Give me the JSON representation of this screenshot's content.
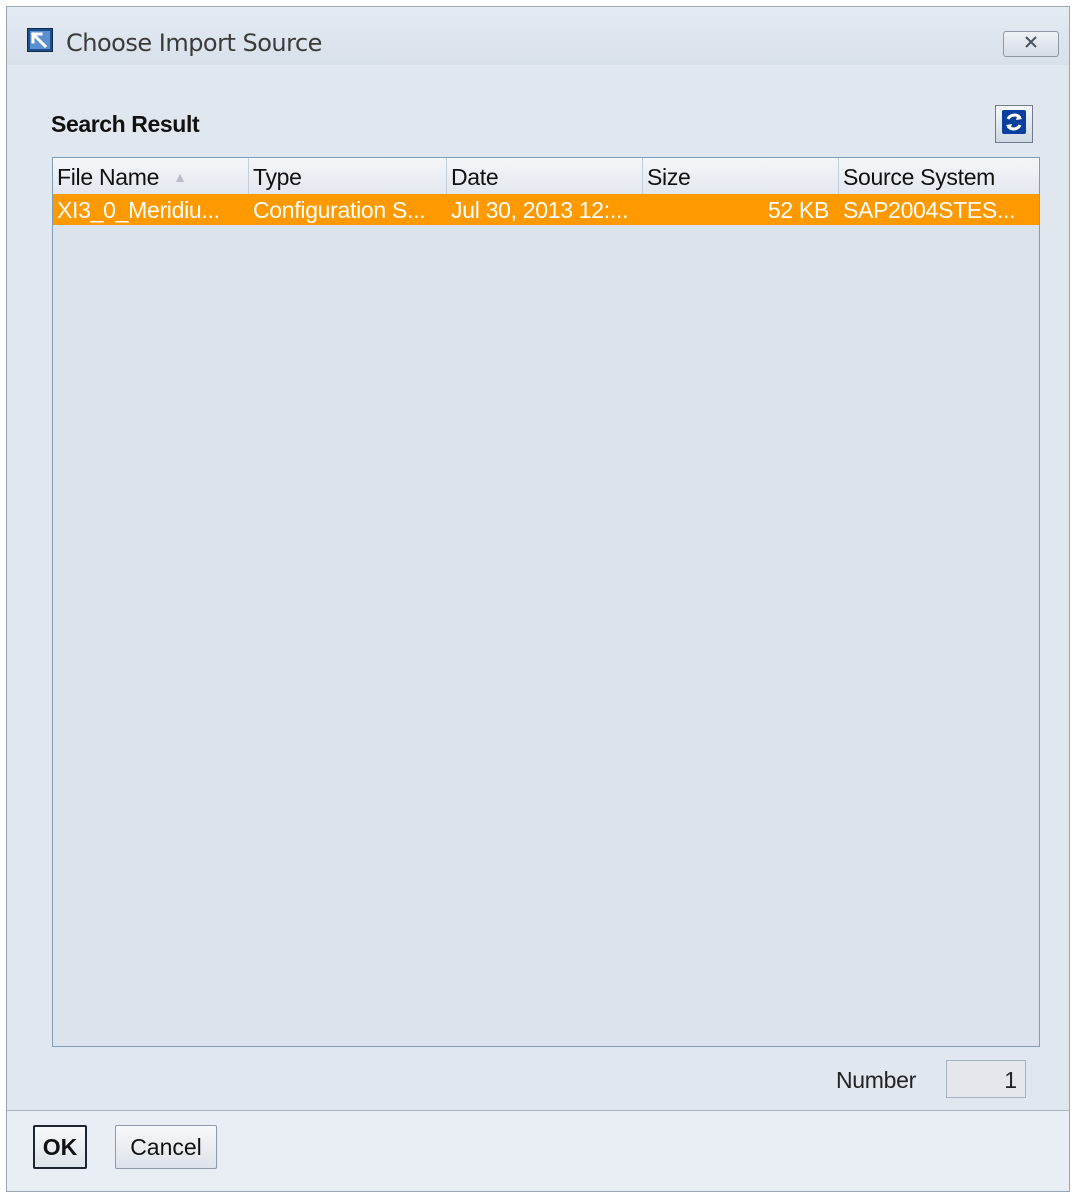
{
  "window": {
    "title": "Choose Import Source"
  },
  "section": {
    "title": "Search Result"
  },
  "table": {
    "columns": [
      "File Name",
      "Type",
      "Date",
      "Size",
      "Source System"
    ],
    "sort_column": "File Name",
    "sort_direction": "ascending",
    "rows": [
      {
        "file_name": "XI3_0_Meridiu...",
        "type": "Configuration S...",
        "date": "Jul 30, 2013 12:...",
        "size": "52 KB",
        "source_system": "SAP2004STES...",
        "selected": true
      }
    ]
  },
  "summary": {
    "number_label": "Number",
    "number_value": "1"
  },
  "buttons": {
    "ok": "OK",
    "cancel": "Cancel"
  },
  "colors": {
    "selected_row": "#ff9900",
    "selected_text": "#ffffff",
    "background": "#e1e7ef"
  },
  "icons": {
    "window_icon": "import-arrow-icon",
    "close": "close-icon",
    "refresh": "refresh-icon",
    "sort": "sort-ascending-icon"
  }
}
